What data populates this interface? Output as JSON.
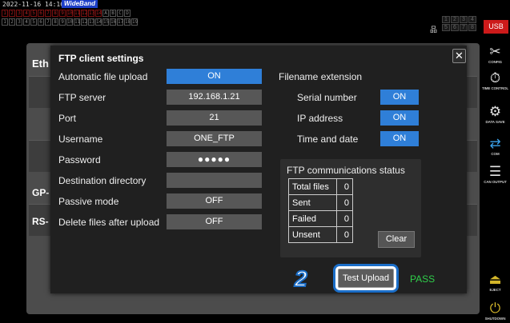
{
  "status_bar": {
    "timestamp": "2022-11-16 14:16:02",
    "mode_badge": "WideBand",
    "channel_row_a": [
      "1",
      "2",
      "3",
      "4",
      "5",
      "6",
      "7",
      "8",
      "9",
      "10",
      "11",
      "12",
      "13",
      "14",
      "A",
      "B",
      "C",
      "D"
    ],
    "channel_row_b": [
      "1",
      "2",
      "3",
      "4",
      "5",
      "6",
      "7",
      "8",
      "9",
      "10",
      "11",
      "12",
      "13",
      "14",
      "15",
      "16",
      "17",
      "18",
      "19"
    ],
    "slots": [
      "1",
      "2",
      "3",
      "4",
      "5",
      "6",
      "7",
      "8"
    ],
    "usb_label": "USB"
  },
  "background": {
    "ethernet_label": "Eth",
    "gpib_label": "GP-",
    "rs232_label": "RS-"
  },
  "sidebar": {
    "items": [
      {
        "icon": "config-icon",
        "glyph": "✂",
        "caption": "CONFIG"
      },
      {
        "icon": "time-control-icon",
        "glyph": "⏱",
        "caption": "TIME CONTROL"
      },
      {
        "icon": "data-save-icon",
        "glyph": "⚙",
        "caption": "DATA SAVE"
      },
      {
        "icon": "com-icon",
        "glyph": "⇄",
        "caption": "COM"
      },
      {
        "icon": "can-output-icon",
        "glyph": "☰",
        "caption": "CAN OUTPUT"
      },
      {
        "icon": "eject-icon",
        "glyph": "⏏",
        "caption": "EJECT"
      },
      {
        "icon": "shutdown-icon",
        "glyph": "⏻",
        "caption": "SHUTDOWN"
      }
    ]
  },
  "dialog": {
    "title": "FTP client settings",
    "close_glyph": "✕",
    "rows": {
      "auto_upload": {
        "label": "Automatic file upload",
        "value": "ON"
      },
      "server": {
        "label": "FTP server",
        "value": "192.168.1.21"
      },
      "port": {
        "label": "Port",
        "value": "21"
      },
      "username": {
        "label": "Username",
        "value": "ONE_FTP"
      },
      "password": {
        "label": "Password",
        "value": "●●●●●"
      },
      "dest_dir": {
        "label": "Destination directory",
        "value": ""
      },
      "passive": {
        "label": "Passive mode",
        "value": "OFF"
      },
      "delete_after": {
        "label": "Delete files after upload",
        "value": "OFF"
      }
    },
    "extension": {
      "title": "Filename extension",
      "serial": {
        "label": "Serial number",
        "value": "ON"
      },
      "ip": {
        "label": "IP address",
        "value": "ON"
      },
      "datetime": {
        "label": "Time and date",
        "value": "ON"
      }
    },
    "status": {
      "title": "FTP communications status",
      "rows": [
        {
          "label": "Total files",
          "value": "0"
        },
        {
          "label": "Sent",
          "value": "0"
        },
        {
          "label": "Failed",
          "value": "0"
        },
        {
          "label": "Unsent",
          "value": "0"
        }
      ],
      "clear_label": "Clear"
    },
    "step_number": "2",
    "test_upload_label": "Test Upload",
    "result": "PASS"
  },
  "colors": {
    "accent_on": "#2f7fd8",
    "field_off": "#575757",
    "pass": "#2fcf4a",
    "usb": "#cc1a1a",
    "callout": "#1b6ec8"
  }
}
